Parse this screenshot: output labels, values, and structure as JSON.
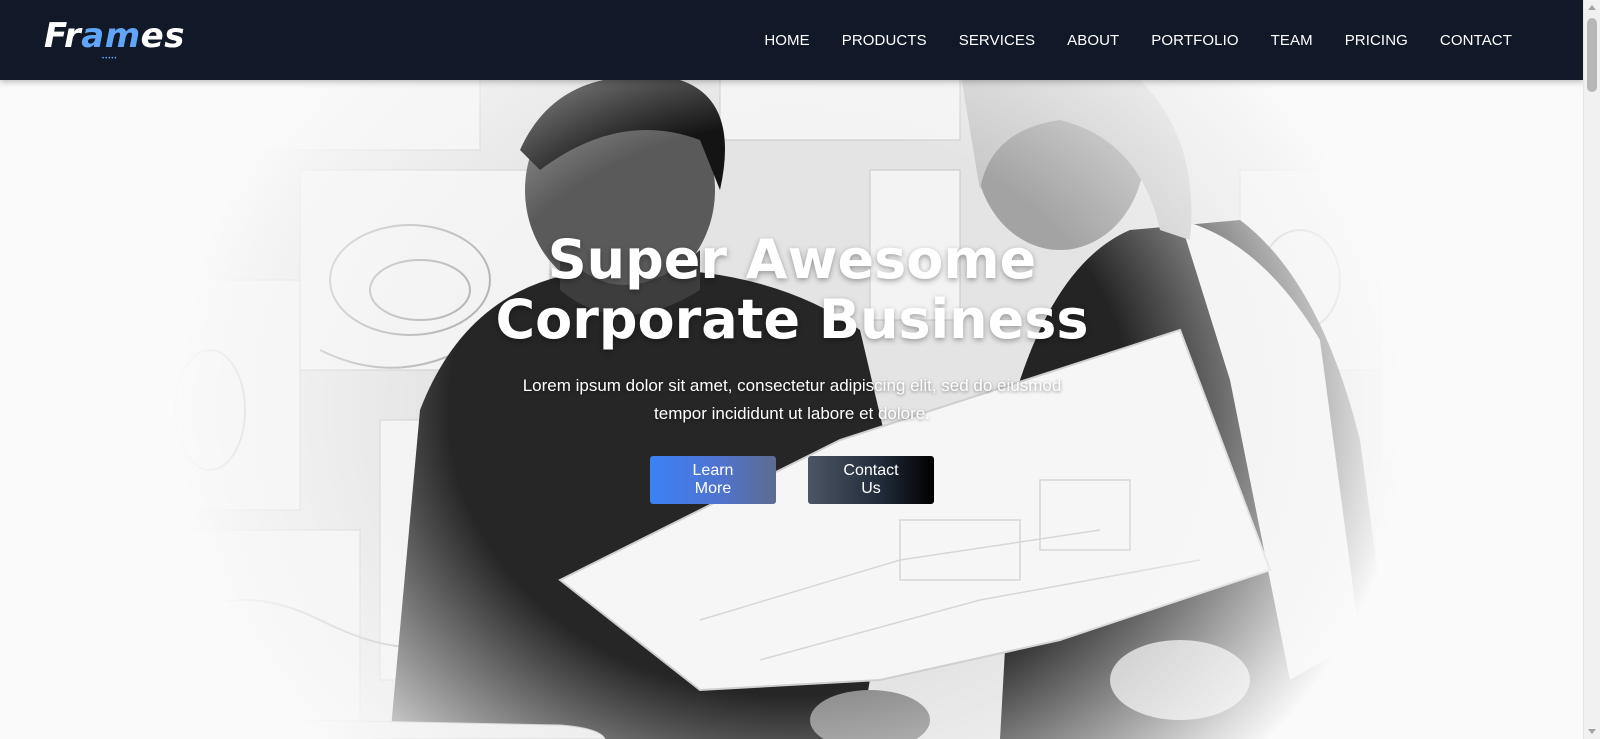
{
  "brand": {
    "logo_part1": "Fr",
    "logo_part2": "am",
    "logo_part3": "es",
    "logo_dots": "•••••",
    "accent_color": "#60a5fa",
    "nav_background": "#111827"
  },
  "nav": {
    "items": [
      {
        "label": "HOME"
      },
      {
        "label": "PRODUCTS"
      },
      {
        "label": "SERVICES"
      },
      {
        "label": "ABOUT"
      },
      {
        "label": "PORTFOLIO"
      },
      {
        "label": "TEAM"
      },
      {
        "label": "PRICING"
      },
      {
        "label": "CONTACT"
      }
    ]
  },
  "hero": {
    "title_line1": "Super Awesome",
    "title_line2": "Corporate Business",
    "subtitle": "Lorem ipsum dolor sit amet, consectetur adipiscing elit, sed do eiusmod tempor incididunt ut labore et dolore.",
    "primary_button": "Learn More",
    "secondary_button": "Contact Us",
    "image_description_icon": "photo-two-people-reviewing-blueprints"
  }
}
